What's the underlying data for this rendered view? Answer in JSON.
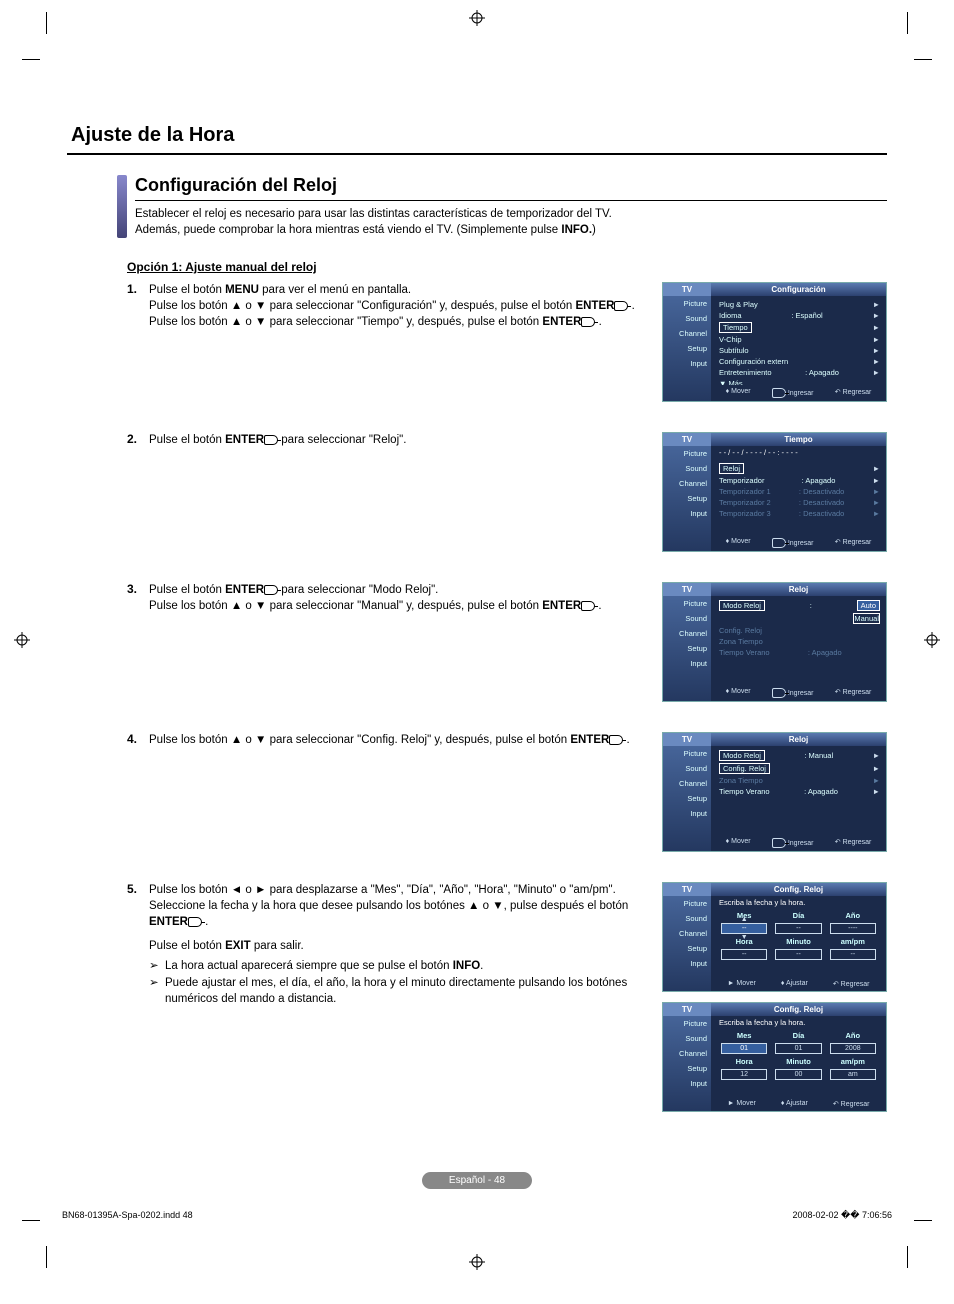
{
  "page": {
    "main_title": "Ajuste de la Hora",
    "sub_title": "Configuración del Reloj",
    "intro_line1": "Establecer el reloj es necesario para usar las distintas características de temporizador del TV.",
    "intro_line2_prefix": "Además, puede comprobar la hora mientras está viendo el TV. (Simplemente pulse ",
    "intro_line2_bold": "INFO.",
    "intro_line2_suffix": ")",
    "option_head": "Opción 1: Ajuste manual del reloj",
    "page_badge": "Español - 48"
  },
  "steps": {
    "s1": {
      "num": "1.",
      "p1a": "Pulse el botón ",
      "p1b": "MENU",
      "p1c": " para ver el menú en pantalla.",
      "p2": "Pulse los botón ▲ o ▼ para seleccionar \"Configuración\" y, después, pulse el botón ",
      "p2b": "ENTER",
      "p2c": " .",
      "p3": "Pulse los botón ▲ o ▼ para seleccionar \"Tiempo\" y, después, pulse el botón ",
      "p3b": "ENTER",
      "p3c": " ."
    },
    "s2": {
      "num": "2.",
      "p1a": "Pulse el botón ",
      "p1b": "ENTER",
      "p1c": "  para seleccionar \"Reloj\"."
    },
    "s3": {
      "num": "3.",
      "p1a": "Pulse el botón ",
      "p1b": "ENTER",
      "p1c": "  para seleccionar \"Modo Reloj\".",
      "p2": "Pulse los botón ▲ o ▼ para seleccionar \"Manual\" y, después, pulse el botón ",
      "p2b": "ENTER",
      "p2c": " ."
    },
    "s4": {
      "num": "4.",
      "p1": "Pulse los botón ▲ o ▼ para seleccionar \"Config. Reloj\" y, después, pulse el botón ",
      "p1b": "ENTER",
      "p1c": " ."
    },
    "s5": {
      "num": "5.",
      "p1": "Pulse los botón ◄ o ► para desplazarse a \"Mes\", \"Día\", \"Año\", \"Hora\", \"Minuto\" o \"am/pm\". Seleccione la fecha y la hora que desee pulsando los botónes ▲ o ▼, pulse después el botón ",
      "p1b": "ENTER",
      "p1c": " .",
      "p2a": "Pulse el botón ",
      "p2b": "EXIT",
      "p2c": " para salir.",
      "li1a": "La hora actual aparecerá siempre que se pulse el botón ",
      "li1b": "INFO",
      "li1c": ".",
      "li2": "Puede ajustar el mes, el día, el año, la hora y el minuto directamente pulsando los botónes numéricos del mando a distancia."
    }
  },
  "panels": {
    "sidebar": {
      "tv": "TV",
      "picture": "Picture",
      "sound": "Sound",
      "channel": "Channel",
      "setup": "Setup",
      "input": "Input"
    },
    "footer": {
      "mover": "Mover",
      "ingresar": "Ingresar",
      "regresar": "Regresar",
      "ajustar": "Ajustar"
    },
    "p1": {
      "title": "Configuración",
      "rows": [
        {
          "lbl": "Plug & Play",
          "val": "",
          "arrow": "►"
        },
        {
          "lbl": "Idioma",
          "val": ": Español",
          "arrow": "►"
        },
        {
          "lbl": "Tiempo",
          "val": "",
          "arrow": "►",
          "sel": true
        },
        {
          "lbl": "V-Chip",
          "val": "",
          "arrow": "►"
        },
        {
          "lbl": "Subtítulo",
          "val": "",
          "arrow": "►"
        },
        {
          "lbl": "Configuración extern",
          "val": "",
          "arrow": "►"
        },
        {
          "lbl": "Entretenimiento",
          "val": ": Apagado",
          "arrow": "►"
        },
        {
          "lbl": "▼ Más",
          "val": "",
          "arrow": ""
        }
      ]
    },
    "p2": {
      "title": "Tiempo",
      "clock_placeholder": "- - / - - / - - - - / - - : - -  - -",
      "rows": [
        {
          "lbl": "Reloj",
          "val": "",
          "arrow": "►",
          "sel": true
        },
        {
          "lbl": "Temporizador",
          "val": ": Apagado",
          "arrow": "►"
        },
        {
          "lbl": "Temporizador 1",
          "val": ": Desactivado",
          "arrow": "►",
          "dim": true
        },
        {
          "lbl": "Temporizador 2",
          "val": ": Desactivado",
          "arrow": "►",
          "dim": true
        },
        {
          "lbl": "Temporizador 3",
          "val": ": Desactivado",
          "arrow": "►",
          "dim": true
        }
      ]
    },
    "p3": {
      "title": "Reloj",
      "rows": [
        {
          "lbl": "Modo Reloj",
          "val": ":",
          "opt1": "Auto",
          "opt2": "Manual",
          "sel": true,
          "hi": "Auto"
        },
        {
          "lbl": "Config. Reloj",
          "val": "",
          "arrow": "",
          "dim": true
        },
        {
          "lbl": "Zona Tiempo",
          "val": "",
          "arrow": "",
          "dim": true
        },
        {
          "lbl": "Tiempo Verano",
          "val": ": Apagado",
          "arrow": "",
          "dim": true
        }
      ]
    },
    "p4": {
      "title": "Reloj",
      "rows": [
        {
          "lbl": "Modo Reloj",
          "val": ": Manual",
          "arrow": "►",
          "sel": true
        },
        {
          "lbl": "Config. Reloj",
          "val": "",
          "arrow": "►",
          "sel2": true
        },
        {
          "lbl": "Zona Tiempo",
          "val": "",
          "arrow": "►",
          "dim": true
        },
        {
          "lbl": "Tiempo Verano",
          "val": ": Apagado",
          "arrow": "►"
        }
      ]
    },
    "p5": {
      "title": "Config. Reloj",
      "subhead": "Escriba la fecha y la hora.",
      "heads": [
        "Mes",
        "Día",
        "Año",
        "Hora",
        "Minuto",
        "am/pm"
      ],
      "cells": [
        "--",
        "--",
        "----",
        "--",
        "--",
        "--"
      ]
    },
    "p6": {
      "title": "Config. Reloj",
      "subhead": "Escriba la fecha y la hora.",
      "heads": [
        "Mes",
        "Día",
        "Año",
        "Hora",
        "Minuto",
        "am/pm"
      ],
      "cells": [
        "01",
        "01",
        "2008",
        "12",
        "00",
        "am"
      ]
    }
  },
  "footerline": {
    "left": "BN68-01395A-Spa-0202.indd   48",
    "right": "2008-02-02   �� 7:06:56"
  }
}
